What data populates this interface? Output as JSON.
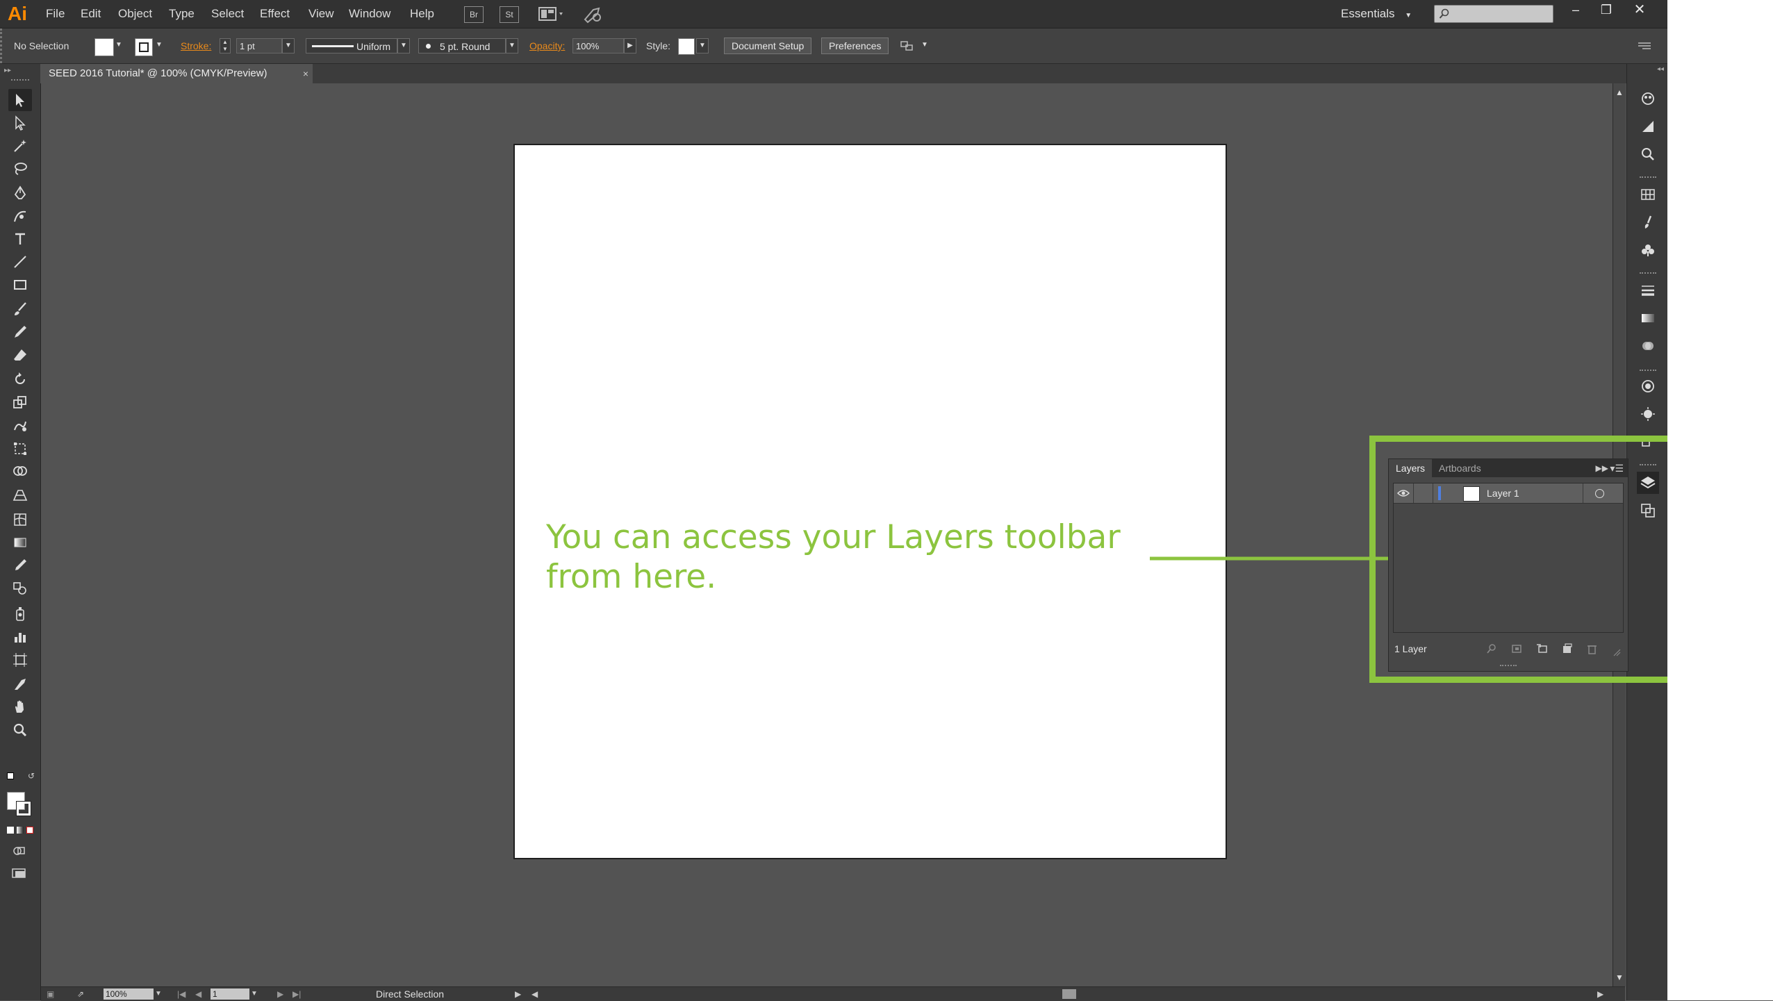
{
  "app": {
    "logo": "Ai",
    "accent_color": "#8cc43f",
    "logo_color": "#ff8a00"
  },
  "menubar": {
    "items": [
      "File",
      "Edit",
      "Object",
      "Type",
      "Select",
      "Effect",
      "View",
      "Window",
      "Help"
    ],
    "badges": [
      "Br",
      "St"
    ],
    "workspace": "Essentials",
    "search_placeholder": "",
    "window_buttons": [
      "minimize",
      "restore",
      "close"
    ]
  },
  "controlbar": {
    "selection": "No Selection",
    "stroke_label": "Stroke:",
    "stroke_weight": "1 pt",
    "stroke_profile": "Uniform",
    "brush": "5 pt. Round",
    "opacity_label": "Opacity:",
    "opacity_value": "100%",
    "style_label": "Style:",
    "document_setup": "Document Setup",
    "preferences": "Preferences"
  },
  "document": {
    "tab_title": "SEED 2016 Tutorial* @ 100% (CMYK/Preview)",
    "tab_close": "×"
  },
  "canvas": {
    "callout_line1": "You can access your Layers toolbar",
    "callout_line2": "from here."
  },
  "layers_panel": {
    "tabs": [
      "Layers",
      "Artboards"
    ],
    "layers": [
      {
        "name": "Layer 1",
        "color": "#4f7fe0",
        "visible": true
      }
    ],
    "count_label": "1 Layer"
  },
  "statusbar": {
    "zoom": "100%",
    "artboard_number": "1",
    "current_tool": "Direct Selection"
  },
  "tools": [
    "selection-tool",
    "direct-selection-tool",
    "magic-wand-tool",
    "lasso-tool",
    "pen-tool",
    "curvature-tool",
    "type-tool",
    "line-tool",
    "rectangle-tool",
    "paintbrush-tool",
    "pencil-tool",
    "eraser-tool",
    "rotate-tool",
    "scale-tool",
    "warp-tool",
    "free-transform-tool",
    "shape-builder-tool",
    "perspective-grid-tool",
    "mesh-tool",
    "gradient-tool",
    "eyedropper-tool",
    "blend-tool",
    "symbol-sprayer-tool",
    "graph-tool",
    "artboard-tool",
    "slice-tool",
    "hand-tool",
    "zoom-tool"
  ],
  "dock_icons": [
    "color-icon",
    "color-guide-icon",
    "cc-libraries-icon",
    "swatches-icon",
    "brushes-icon",
    "symbols-icon",
    "stroke-icon",
    "gradient-icon",
    "transparency-icon",
    "appearance-icon",
    "graphic-styles-icon",
    "asset-export-icon",
    "layers-icon",
    "artboards-icon"
  ]
}
